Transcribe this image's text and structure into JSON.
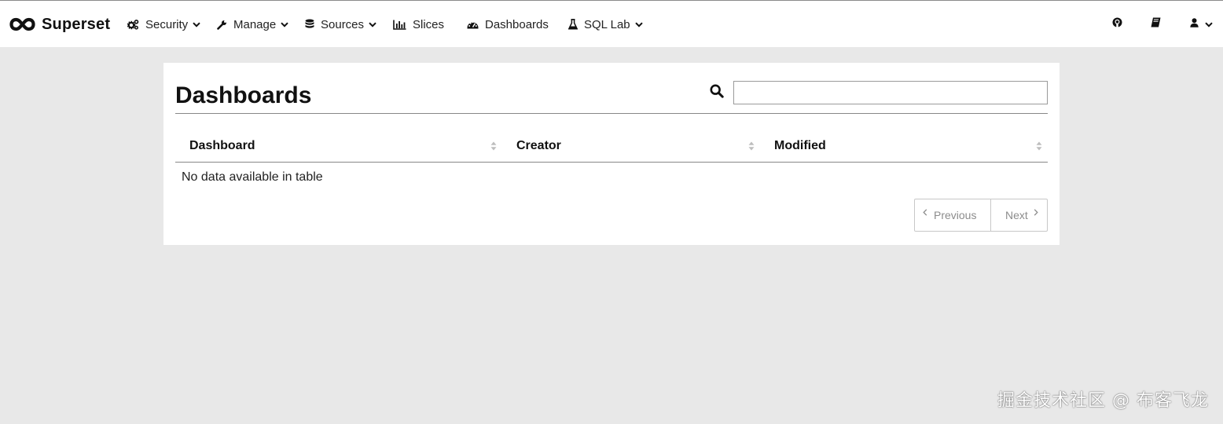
{
  "navbar": {
    "brand": {
      "name": "Superset",
      "icon": "infinity-logo-icon"
    },
    "items": [
      {
        "label": "Security",
        "icon": "cogs-icon",
        "dropdown": true
      },
      {
        "label": "Manage",
        "icon": "wrench-icon",
        "dropdown": true
      },
      {
        "label": "Sources",
        "icon": "database-icon",
        "dropdown": true
      },
      {
        "label": "Slices",
        "icon": "bar-chart-icon",
        "dropdown": false
      },
      {
        "label": "Dashboards",
        "icon": "dashboard-gauge-icon",
        "dropdown": false
      },
      {
        "label": "SQL Lab",
        "icon": "flask-icon",
        "dropdown": true
      }
    ],
    "right": [
      {
        "icon": "github-icon"
      },
      {
        "icon": "book-icon"
      },
      {
        "icon": "user-icon",
        "dropdown": true
      }
    ]
  },
  "page": {
    "title": "Dashboards",
    "search": {
      "value": "",
      "placeholder": "",
      "icon": "search-icon"
    }
  },
  "table": {
    "columns": [
      {
        "label": "Dashboard"
      },
      {
        "label": "Creator"
      },
      {
        "label": "Modified"
      }
    ],
    "rows": [],
    "empty_text": "No data available in table"
  },
  "pagination": {
    "previous_label": "Previous",
    "next_label": "Next"
  },
  "watermark": {
    "text": "掘金技术社区 @ 布客飞龙"
  },
  "colors": {
    "page_background": "#e8e8e8",
    "navbar_background": "#ffffff",
    "card_background": "#ffffff",
    "text_primary": "#111111",
    "pagination_text": "#8c8c8c"
  }
}
